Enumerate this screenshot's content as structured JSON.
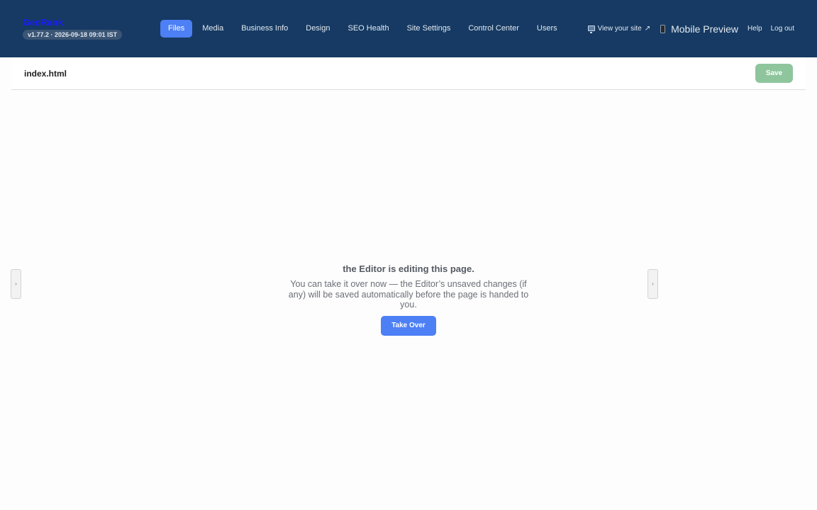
{
  "brand": {
    "name": "GeoRank",
    "version": "v1.77.2 · 2026-09-18 09:01 IST"
  },
  "nav": {
    "items": [
      {
        "label": "Files",
        "active": true
      },
      {
        "label": "Media"
      },
      {
        "label": "Business Info"
      },
      {
        "label": "Design"
      },
      {
        "label": "SEO Health"
      },
      {
        "label": "Site Settings"
      },
      {
        "label": "Control Center"
      },
      {
        "label": "Users"
      }
    ]
  },
  "actions": {
    "view_site": "View your site",
    "view_site_arrow": "↗",
    "mobile_preview": "Mobile Preview",
    "help": "Help",
    "logout": "Log out"
  },
  "file": {
    "name": "index.html",
    "save_label": "Save"
  },
  "side_toggles": {
    "left_glyph": "›",
    "right_glyph": "›"
  },
  "takeover": {
    "title": "the Editor is editing this page.",
    "message": "You can take it over now — the Editor’s unsaved changes (if any) will be saved automatically before the page is handed to you.",
    "button_label": "Take Over"
  },
  "colors": {
    "topbar": "#163a63",
    "accent": "#4d7ff5",
    "save_disabled": "#8ec59d",
    "brand": "#1a1aff"
  }
}
